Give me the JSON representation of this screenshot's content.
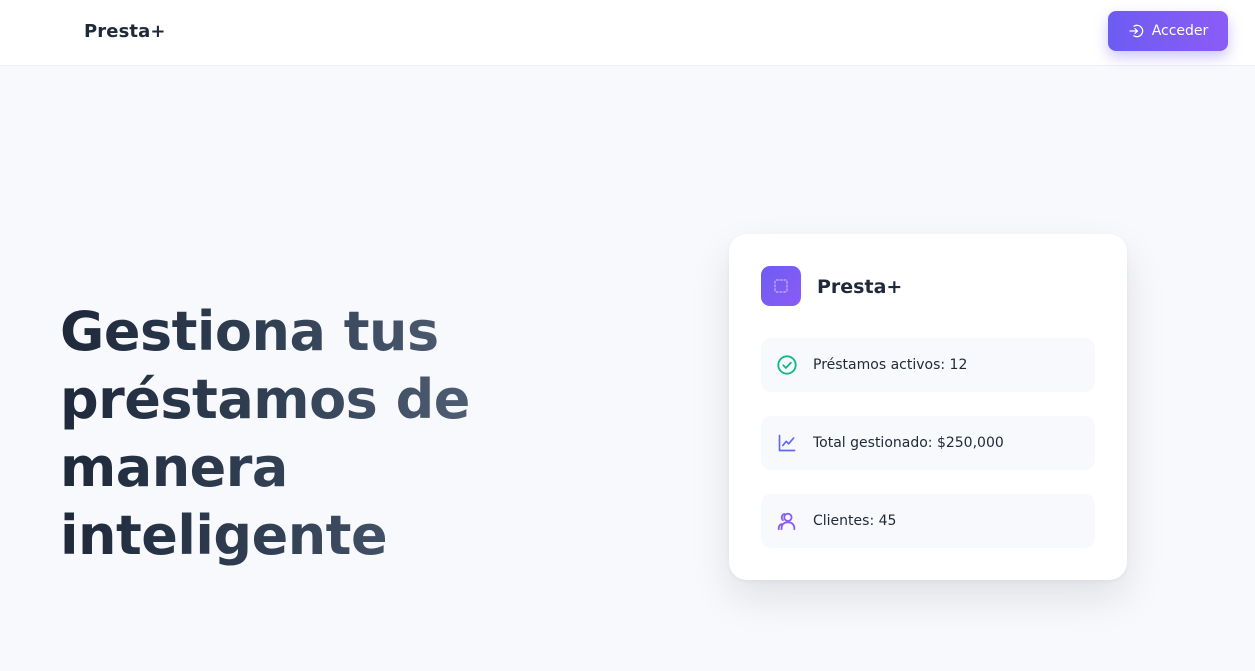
{
  "header": {
    "brand": "Presta+",
    "login_label": "Acceder",
    "login_icon": "login-icon"
  },
  "hero": {
    "title": "Gestiona tus préstamos de manera inteligente"
  },
  "card": {
    "logo_icon": "dashed-square-icon",
    "title": "Presta+",
    "stats": [
      {
        "icon": "check-circle-icon",
        "color": "#10b981",
        "label": "Préstamos activos: 12"
      },
      {
        "icon": "chart-line-icon",
        "color": "#6366f1",
        "label": "Total gestionado: $250,000"
      },
      {
        "icon": "users-icon",
        "color": "#8b5cf6",
        "label": "Clientes: 45"
      }
    ]
  },
  "colors": {
    "accent_start": "#6d5cf2",
    "accent_end": "#8b5cf6",
    "background": "#f8f9fc"
  }
}
